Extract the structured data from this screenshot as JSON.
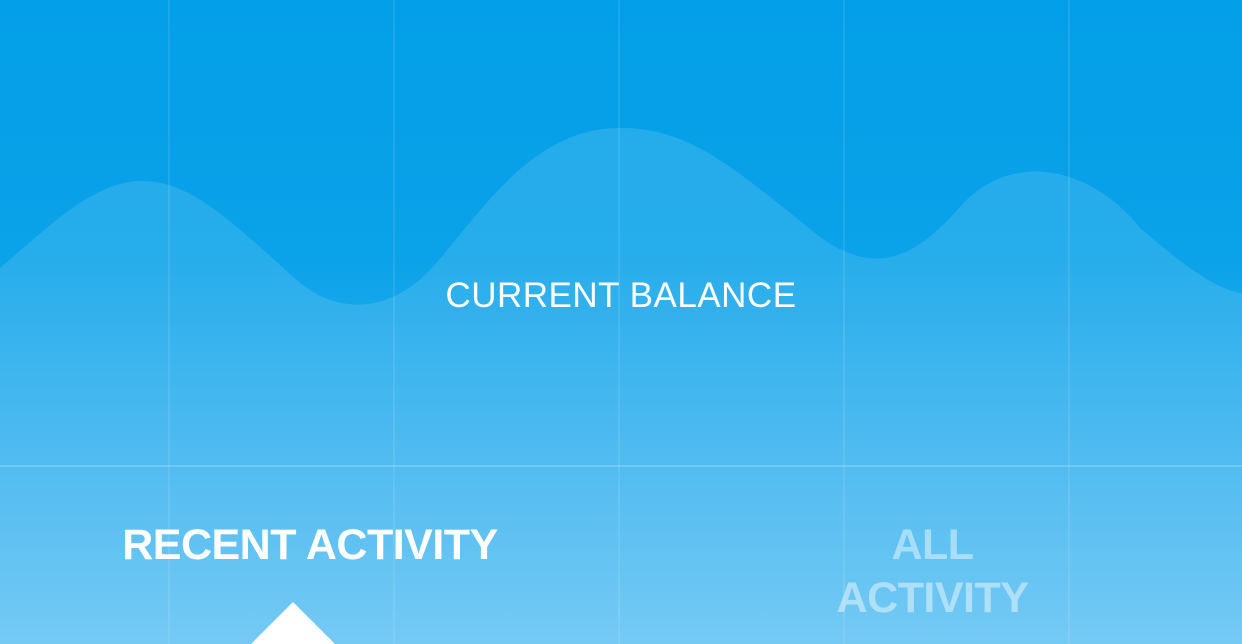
{
  "balance": {
    "label": "CURRENT BALANCE"
  },
  "tabs": {
    "recent": {
      "label": "RECENT ACTIVITY",
      "active": true
    },
    "all": {
      "label_line1": "ALL",
      "label_line2": "ACTIVITY",
      "active": false
    }
  },
  "colors": {
    "background_top": "#039fe8",
    "background_bottom": "#62c3f3",
    "text_active": "#ffffff",
    "text_inactive": "rgba(255,255,255,0.45)"
  }
}
